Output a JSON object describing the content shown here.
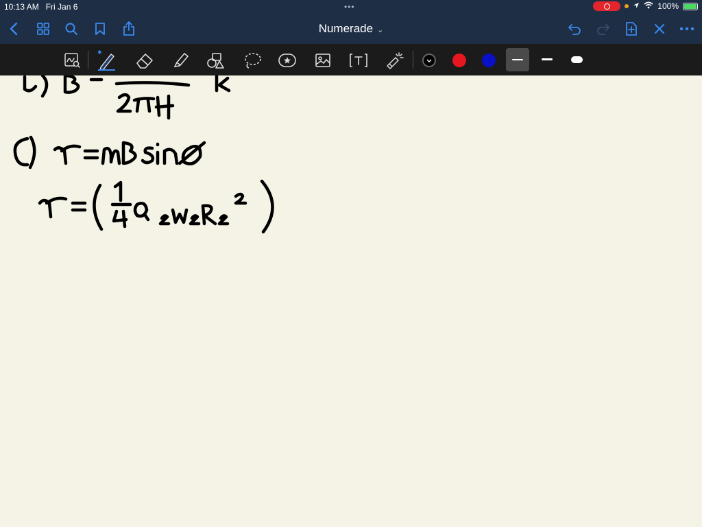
{
  "status": {
    "time": "10:13 AM",
    "date": "Fri Jan 6",
    "battery": "100%",
    "battery_level": 1.0
  },
  "nav": {
    "title": "Numerade",
    "title_chevron": "⌄"
  },
  "toolbar": {
    "colors": [
      "#000000",
      "#e8161e",
      "#0a10c8"
    ],
    "stroke_sizes": [
      "thin",
      "medium",
      "thick"
    ]
  },
  "handwriting": {
    "line1": "b) B = ——— k̂",
    "line1_denominator": "2πH",
    "line2": "C) τ = μBsinθ",
    "line3": "τ = (¼ Q₂w₂R₂²)"
  }
}
